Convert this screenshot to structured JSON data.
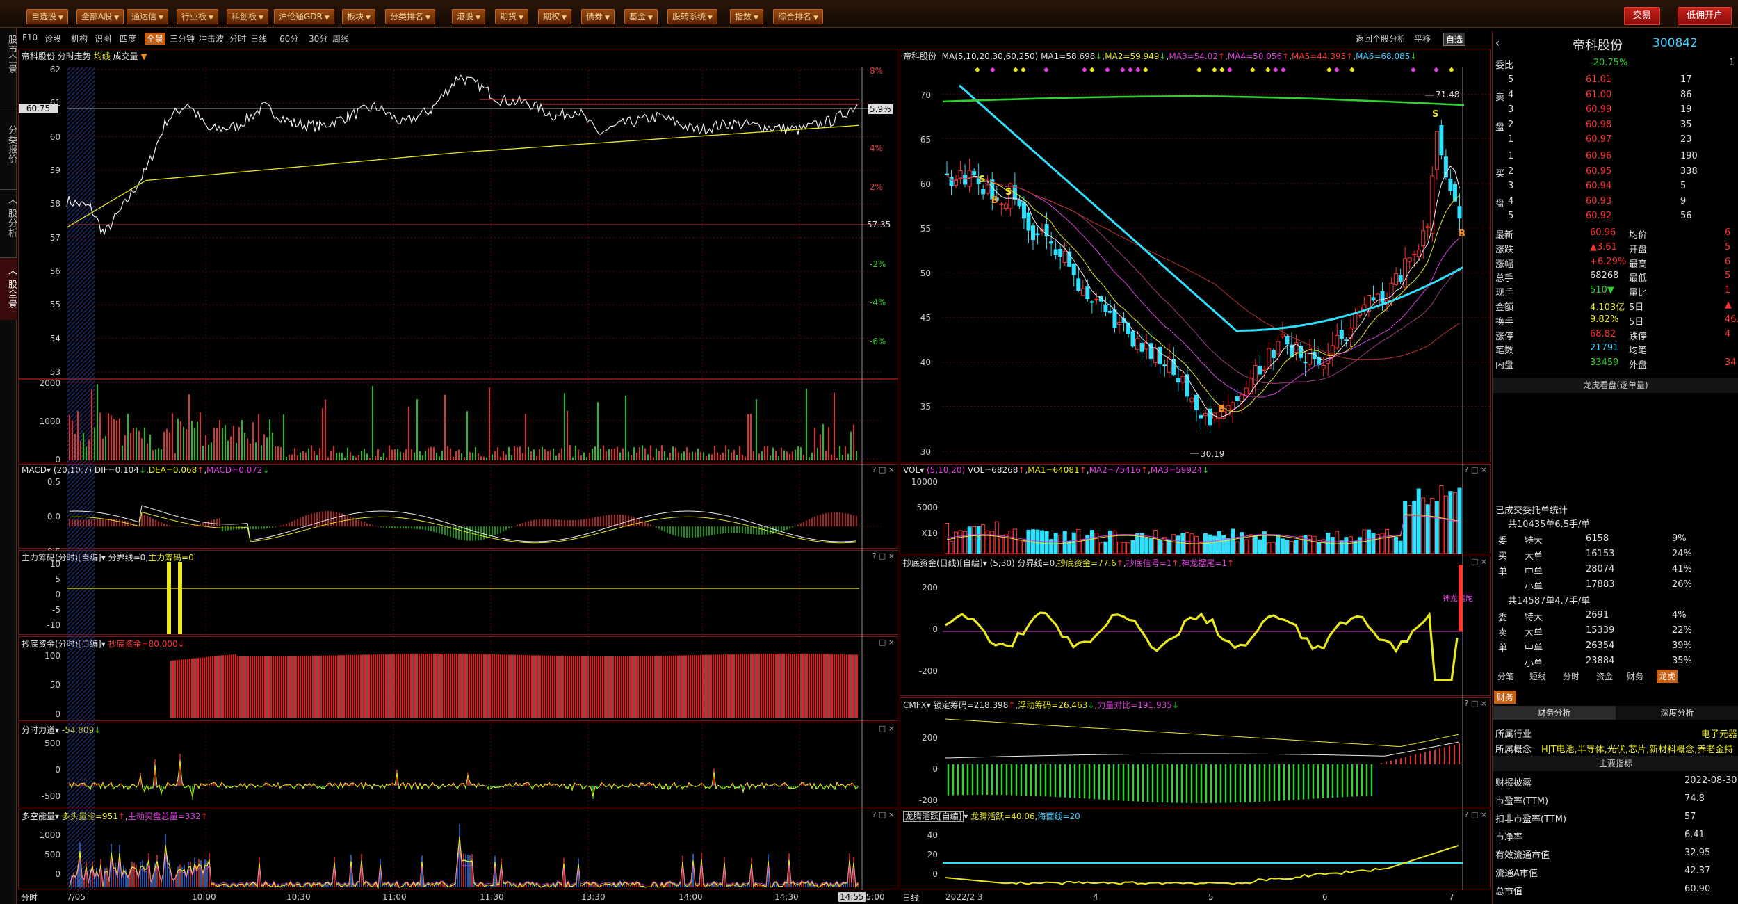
{
  "toolbar": {
    "buttons": [
      "自选股",
      "全部A股",
      "通达信",
      "行业板",
      "科创板",
      "沪伦通GDR",
      "板块",
      "分类排名",
      "港股",
      "期货",
      "期权",
      "债券",
      "基金",
      "股转系统",
      "指数",
      "综合排名"
    ],
    "trade_label": "交易",
    "open_account_label": "低佣开户"
  },
  "left_tabs": [
    "股市全景",
    "分类报价",
    "个股分析",
    "个股全景"
  ],
  "subbar": {
    "items": [
      "F10",
      "诊股",
      "机构",
      "识图",
      "四度",
      "全景",
      "三分钟",
      "冲击波",
      "分时",
      "日线",
      "60分",
      "30分",
      "周线"
    ],
    "selected": "全景",
    "right": [
      "返回个股分析",
      "平移",
      "自选"
    ]
  },
  "intraday": {
    "title_name": "帝科股份",
    "title_mode": "分时走势",
    "title_avg": "均线",
    "title_vol": "成交量",
    "price_labels": [
      "62",
      "61",
      "60",
      "59",
      "58",
      "57",
      "56",
      "55",
      "54",
      "53"
    ],
    "pct_labels": [
      "8%",
      "6%",
      "4%",
      "2%",
      "",
      "-2%",
      "-4%",
      "-6%"
    ],
    "current_price": "60.75",
    "current_pct": "5.9%",
    "prev_close": "57.35",
    "vol_labels": [
      "2000",
      "1000",
      "0"
    ],
    "time_labels": [
      "7/05",
      "10:00",
      "10:30",
      "11:00",
      "11:30",
      "13:30",
      "14:00",
      "14:30",
      "14:55",
      "15:00"
    ],
    "time_mode": "分时"
  },
  "macd_intraday": {
    "title": "MACD",
    "params": "(20,10,7)",
    "dif": "DIF=0.104",
    "dea": "DEA=0.068",
    "macd": "MACD=0.072",
    "labels": [
      "0.5",
      "0.0",
      "-0.5"
    ]
  },
  "zlcm": {
    "title": "主力筹码(分时)[自编]",
    "v1": "分界线=0",
    "v2": "主力筹码=0",
    "labels": [
      "10",
      "5",
      "0",
      "-5",
      "-10"
    ]
  },
  "cdzj_intraday": {
    "title": "抄底资金(分时)[自编]",
    "v1": "抄底资金=80.000",
    "labels": [
      "100",
      "50",
      "0"
    ]
  },
  "fsld": {
    "title": "分时力道",
    "v1": "-54.809",
    "labels": [
      "500",
      "0",
      "-500"
    ]
  },
  "dkny": {
    "title": "多空能量",
    "v1": "多头量能=951",
    "v2": "主动买盘总量=332",
    "labels": [
      "1000",
      "500",
      "0"
    ]
  },
  "daily": {
    "title": "帝科股份",
    "ma_params": "MA(5,10,20,30,60,250)",
    "ma1": "MA1=58.698",
    "ma2": "MA2=59.949",
    "ma3": "MA3=54.02",
    "ma4": "MA4=50.056",
    "ma5": "MA5=44.395",
    "ma6": "MA6=68.085",
    "price_labels": [
      "70",
      "65",
      "60",
      "55",
      "50",
      "45",
      "40",
      "35",
      "30"
    ],
    "high_mark": "71.48",
    "low_mark": "30.19",
    "date_labels": [
      "2022/2",
      "3",
      "4",
      "5",
      "6",
      "7"
    ],
    "mode": "日线"
  },
  "vol_daily": {
    "title": "VOL",
    "params": "(5,10,20)",
    "vol": "VOL=68268",
    "ma1": "MA1=64081",
    "ma2": "MA2=75416",
    "ma3": "MA3=59924",
    "labels": [
      "10000",
      "5000",
      "X10"
    ]
  },
  "cdzj_daily": {
    "title": "抄底资金(日线)[自编]",
    "params": "(5,30)",
    "v1": "分界线=0",
    "v2": "抄底资金=77.6",
    "v3": "抄底信号=1",
    "v4": "神龙摆尾=1",
    "labels": [
      "200",
      "0",
      "-200"
    ],
    "tag": "神龙摆尾"
  },
  "cmfx": {
    "title": "CMFX",
    "v1": "锁定筹码=218.398",
    "v2": "浮动筹码=26.463",
    "v3": "力量对比=191.935",
    "labels": [
      "200",
      "0",
      "-200"
    ]
  },
  "lthy": {
    "title": "龙腾活跃[自编]",
    "v1": "龙腾活跃=40.06",
    "v2": "海面线=20",
    "labels": [
      "40",
      "20",
      "0"
    ]
  },
  "quote": {
    "name": "帝科股份",
    "code": "300842",
    "weibi_label": "委比",
    "weibi": "-20.75%",
    "weibi_diff": "1",
    "sell_side": "卖",
    "buy_side": "买",
    "pan": "盘",
    "sells": [
      [
        "5",
        "61.01",
        "17"
      ],
      [
        "4",
        "61.00",
        "86"
      ],
      [
        "3",
        "60.99",
        "19"
      ],
      [
        "2",
        "60.98",
        "35"
      ],
      [
        "1",
        "60.97",
        "23"
      ]
    ],
    "buys": [
      [
        "1",
        "60.96",
        "190"
      ],
      [
        "2",
        "60.95",
        "338"
      ],
      [
        "3",
        "60.94",
        "5"
      ],
      [
        "4",
        "60.93",
        "9"
      ],
      [
        "5",
        "60.92",
        "56"
      ]
    ],
    "stats": [
      [
        "最新",
        "60.96",
        "均价",
        "6"
      ],
      [
        "涨跌",
        "▲3.61",
        "开盘",
        "5"
      ],
      [
        "涨幅",
        "+6.29%",
        "最高",
        "6"
      ],
      [
        "总手",
        "68268",
        "最低",
        "5"
      ],
      [
        "现手",
        "510▼",
        "量比",
        "1"
      ],
      [
        "金额",
        "4.103亿",
        "5日",
        "▲"
      ],
      [
        "换手",
        "9.82%",
        "5日",
        "46."
      ],
      [
        "涨停",
        "68.82",
        "跌停",
        "4"
      ],
      [
        "笔数",
        "21791",
        "均笔",
        ""
      ],
      [
        "内盘",
        "33459",
        "外盘",
        "34"
      ]
    ],
    "dragon_title": "龙虎看盘(逐单量)",
    "entrust_title": "已成交委托单统计",
    "buy_total": "共10435单6.5手/单",
    "buy_rows": [
      [
        "委",
        "特大",
        "6158",
        "9%"
      ],
      [
        "买",
        "大单",
        "16153",
        "24%"
      ],
      [
        "单",
        "中单",
        "28074",
        "41%"
      ],
      [
        "",
        "小单",
        "17883",
        "26%"
      ]
    ],
    "sell_total": "共14587单4.7手/单",
    "sell_rows": [
      [
        "委",
        "特大",
        "2691",
        "4%"
      ],
      [
        "卖",
        "大单",
        "15339",
        "22%"
      ],
      [
        "单",
        "中单",
        "26354",
        "39%"
      ],
      [
        "",
        "小单",
        "23884",
        "35%"
      ]
    ],
    "tabs": [
      "分笔",
      "短线",
      "分时",
      "资金",
      "财务",
      "龙虎"
    ],
    "tab_selected": "龙虎",
    "fin_tab": "财务",
    "fin_subtabs": [
      "财务分析",
      "深度分析"
    ],
    "industry_label": "所属行业",
    "industry": "电子元器",
    "concept_label": "所属概念",
    "concept": "HJT电池,半导体,光伏,芯片,新材料概念,养老金持",
    "main_index": "主要指标",
    "fin_rows": [
      [
        "财报披露",
        "2022-08-30"
      ],
      [
        "市盈率(TTM)",
        "74.8"
      ],
      [
        "扣非市盈率(TTM)",
        "57"
      ],
      [
        "市净率",
        "6.41"
      ],
      [
        "有效流通市值",
        "32.95"
      ],
      [
        "流通A市值",
        "42.37"
      ],
      [
        "总市值",
        "60.90"
      ]
    ]
  },
  "colors": {
    "red": "#ff3232",
    "green": "#30d030",
    "yellow": "#e8e820",
    "cyan": "#30e0ff",
    "border": "#7a1010"
  }
}
